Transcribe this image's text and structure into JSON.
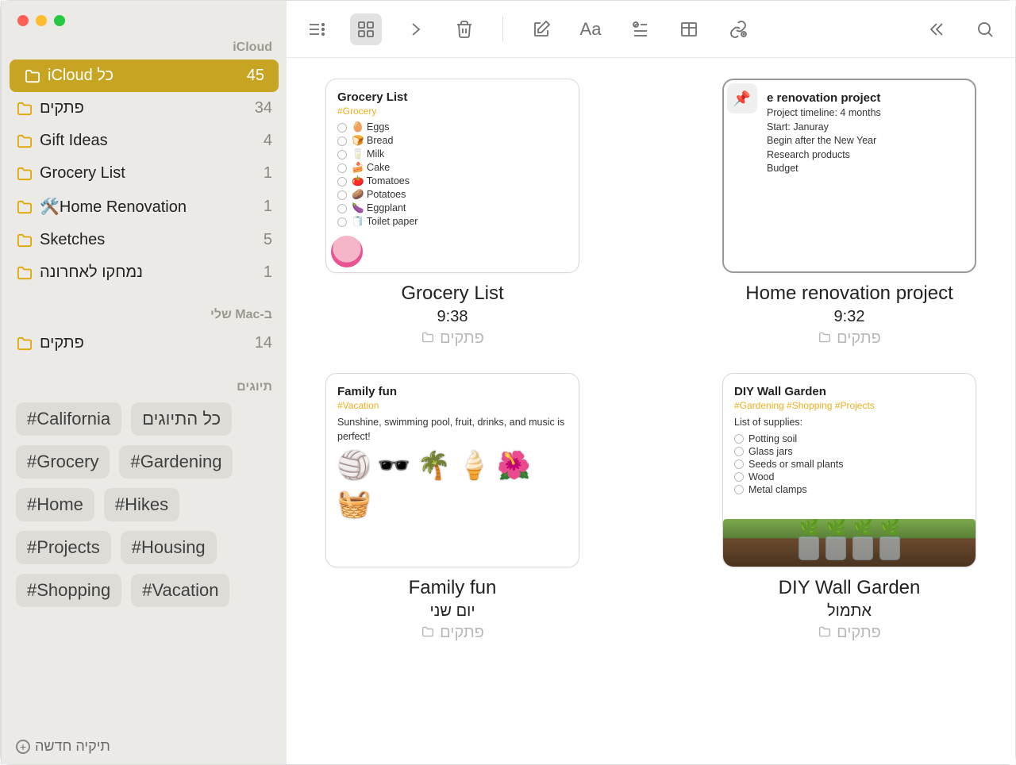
{
  "sidebar": {
    "account1": "iCloud",
    "account2": "ב-Mac שלי",
    "folders1": [
      {
        "name": "כל iCloud",
        "count": 45,
        "selected": true
      },
      {
        "name": "פתקים",
        "count": 34
      },
      {
        "name": "Gift Ideas",
        "count": 4
      },
      {
        "name": "Grocery List",
        "count": 1
      },
      {
        "name": "Home Renovation🛠️",
        "count": 1
      },
      {
        "name": "Sketches",
        "count": 5
      },
      {
        "name": "נמחקו לאחרונה",
        "count": 1
      }
    ],
    "folders2": [
      {
        "name": "פתקים",
        "count": 14
      }
    ],
    "tags_title": "תיוגים",
    "tags": [
      "כל התיוגים",
      "#California",
      "#Gardening",
      "#Grocery",
      "#Hikes",
      "#Home",
      "#Housing",
      "#Projects",
      "#Vacation",
      "#Shopping"
    ],
    "new_folder": "תיקיה חדשה"
  },
  "notes": [
    {
      "thumb_title": "Grocery List",
      "thumb_tags": "#Grocery",
      "title": "Grocery List",
      "time": "9:38",
      "folder": "פתקים",
      "avatar": true,
      "items": [
        "🥚 Eggs",
        "🍞 Bread",
        "🥛 Milk",
        "🍰 Cake",
        "🍅 Tomatoes",
        "🥔 Potatoes",
        "🍆 Eggplant",
        "🧻 Toilet paper"
      ]
    },
    {
      "thumb_title": "Home renovation project",
      "thumb_tags": "",
      "title": "Home renovation project",
      "time": "9:32",
      "folder": "פתקים",
      "pinned": true,
      "body": [
        "Project timeline: 4 months",
        "Start: Januray",
        "Begin after the New Year",
        "Research products",
        "Budget"
      ]
    },
    {
      "thumb_title": "Family fun",
      "thumb_tags": "#Vacation",
      "title": "Family fun",
      "time": "יום שני",
      "folder": "פתקים",
      "body_inline": "Sunshine, swimming pool, fruit, drinks, and music is perfect!",
      "stickers": [
        "🏐",
        "🕶️",
        "🌴",
        "🍦",
        "🌺",
        "🧺"
      ]
    },
    {
      "thumb_title": "DIY Wall Garden",
      "thumb_tags": "#Gardening #Shopping #Projects",
      "title": "DIY Wall Garden",
      "time": "אתמול",
      "folder": "פתקים",
      "supplies_label": "List of supplies:",
      "supplies": [
        "Potting soil",
        "Glass jars",
        "Seeds or small plants",
        "Wood",
        "Metal clamps"
      ],
      "garden": true
    }
  ]
}
